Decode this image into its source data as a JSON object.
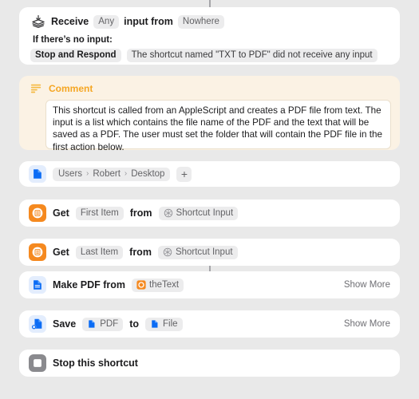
{
  "app": {
    "name": "Shortcuts Editor"
  },
  "colors": {
    "background": "#e9e9e9",
    "card": "#ffffff",
    "comment_card": "#fbf2e4",
    "comment_accent": "#f5a623",
    "orange_icon": "#f5891f",
    "blue_icon": "#0b6cf5",
    "blue_icon_bg": "#e3edfd",
    "gray_icon": "#8a8a8e",
    "pill": "#ececed",
    "pill_text": "#636366"
  },
  "receive": {
    "label": "Receive",
    "type_token": "Any",
    "middle_label": "input from",
    "source_token": "Nowhere",
    "no_input_label": "If there’s no input:",
    "no_input_action": "Stop and Respond",
    "no_input_message": "The shortcut named \"TXT to PDF\" did not receive any input"
  },
  "comment": {
    "title": "Comment",
    "body": "This shortcut is called from an AppleScript and creates a PDF file from text. The input is a list which contains the file name of the PDF and the text that will be saved as a PDF. The user must set the folder that will contain the PDF file in the first action below."
  },
  "folder_action": {
    "crumbs": [
      "Users",
      "Robert",
      "Desktop"
    ],
    "separator": "›",
    "add_label": "+"
  },
  "get_first": {
    "verb": "Get",
    "item_token": "First Item",
    "preposition": "from",
    "source_token": "Shortcut Input"
  },
  "get_last": {
    "verb": "Get",
    "item_token": "Last Item",
    "preposition": "from",
    "source_token": "Shortcut Input"
  },
  "make_pdf": {
    "label": "Make PDF from",
    "variable_token": "theText",
    "show_more": "Show More"
  },
  "save": {
    "verb": "Save",
    "what_token": "PDF",
    "preposition": "to",
    "where_token": "File",
    "show_more": "Show More"
  },
  "stop": {
    "label": "Stop this shortcut"
  }
}
